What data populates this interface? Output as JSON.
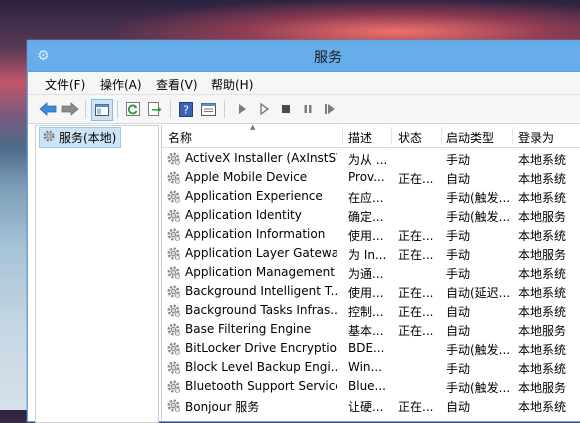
{
  "window": {
    "title": "服务"
  },
  "menu": [
    "文件(F)",
    "操作(A)",
    "查看(V)",
    "帮助(H)"
  ],
  "tree": {
    "root": "服务(本地)"
  },
  "columns": [
    "名称",
    "描述",
    "状态",
    "启动类型",
    "登录为"
  ],
  "services": [
    {
      "name": "ActiveX Installer (AxInstSV)",
      "desc": "为从 ...",
      "status": "",
      "start": "手动",
      "logon": "本地系统"
    },
    {
      "name": "Apple Mobile Device",
      "desc": "Prov...",
      "status": "正在...",
      "start": "自动",
      "logon": "本地系统"
    },
    {
      "name": "Application Experience",
      "desc": "在应...",
      "status": "",
      "start": "手动(触发...",
      "logon": "本地系统"
    },
    {
      "name": "Application Identity",
      "desc": "确定...",
      "status": "",
      "start": "手动(触发...",
      "logon": "本地服务"
    },
    {
      "name": "Application Information",
      "desc": "使用...",
      "status": "正在...",
      "start": "手动",
      "logon": "本地系统"
    },
    {
      "name": "Application Layer Gatewa...",
      "desc": "为 In...",
      "status": "正在...",
      "start": "手动",
      "logon": "本地服务"
    },
    {
      "name": "Application Management",
      "desc": "为通...",
      "status": "",
      "start": "手动",
      "logon": "本地系统"
    },
    {
      "name": "Background Intelligent T...",
      "desc": "使用...",
      "status": "正在...",
      "start": "自动(延迟...",
      "logon": "本地系统"
    },
    {
      "name": "Background Tasks Infras...",
      "desc": "控制...",
      "status": "正在...",
      "start": "自动",
      "logon": "本地系统"
    },
    {
      "name": "Base Filtering Engine",
      "desc": "基本...",
      "status": "正在...",
      "start": "自动",
      "logon": "本地服务"
    },
    {
      "name": "BitLocker Drive Encryptio...",
      "desc": "BDE...",
      "status": "",
      "start": "手动(触发...",
      "logon": "本地系统"
    },
    {
      "name": "Block Level Backup Engi...",
      "desc": "Win...",
      "status": "",
      "start": "手动",
      "logon": "本地系统"
    },
    {
      "name": "Bluetooth Support Service",
      "desc": "Blue...",
      "status": "",
      "start": "手动(触发...",
      "logon": "本地服务"
    },
    {
      "name": "Bonjour 服务",
      "desc": "让硬...",
      "status": "正在...",
      "start": "自动",
      "logon": "本地系统"
    }
  ],
  "icons": {
    "title": "gear-icon",
    "toolbar": [
      "back-icon",
      "forward-icon",
      "show-hide-tree-icon",
      "refresh-icon",
      "export-list-icon",
      "help-icon",
      "properties-icon",
      "start-service-icon",
      "start-service-alt-icon",
      "stop-service-icon",
      "pause-service-icon",
      "restart-service-icon"
    ],
    "row": "service-gear-icon"
  },
  "colors": {
    "titlebar": "#66aeea",
    "selection": "#cce4f7"
  }
}
